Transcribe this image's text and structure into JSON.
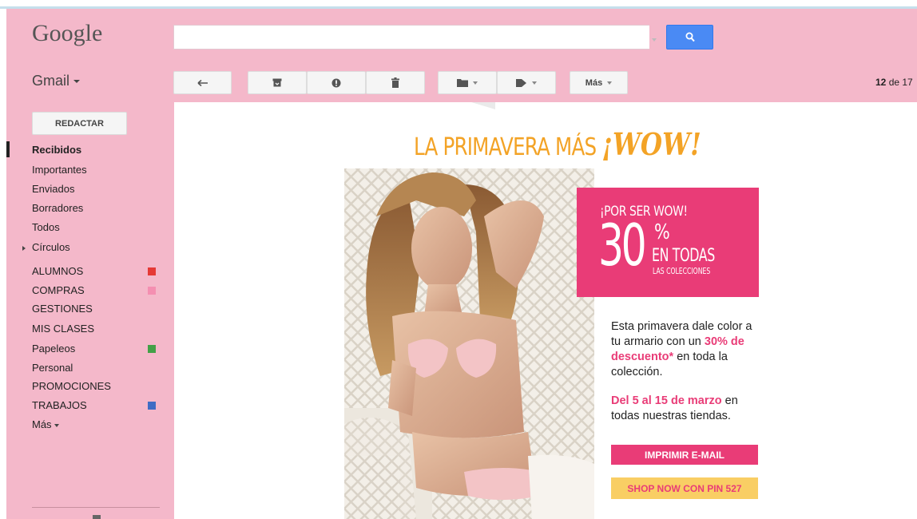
{
  "header": {
    "logo": "Google",
    "search": {
      "value": "",
      "placeholder": ""
    }
  },
  "toolbar": {
    "app_menu": "Gmail",
    "more_label": "Más",
    "counter_range": "12",
    "counter_of": "de 17"
  },
  "sidebar": {
    "compose_label": "REDACTAR",
    "items": [
      {
        "label": "Recibidos",
        "active": true
      },
      {
        "label": "Importantes"
      },
      {
        "label": "Enviados"
      },
      {
        "label": "Borradores"
      },
      {
        "label": "Todos"
      },
      {
        "label": "Círculos"
      }
    ],
    "labels": [
      {
        "label": "ALUMNOS",
        "color": "#e53935"
      },
      {
        "label": "COMPRAS",
        "color": "#f48fb1"
      },
      {
        "label": "GESTIONES",
        "color": ""
      },
      {
        "label": "MIS CLASES",
        "color": ""
      },
      {
        "label": "Papeleos",
        "color": "#43a047"
      },
      {
        "label": "Personal",
        "color": ""
      },
      {
        "label": "PROMOCIONES",
        "color": ""
      },
      {
        "label": "TRABAJOS",
        "color": "#3f6cc4"
      }
    ],
    "more_label": "Más"
  },
  "email": {
    "headline_main": "LA PRIMAVERA MÁS",
    "headline_wow": "¡WOW!",
    "promo": {
      "title": "¡POR SER WOW!",
      "percent": "30",
      "percent_sign": "%",
      "line1": "EN TODAS",
      "line2": "LAS COLECCIONES"
    },
    "body1_pre": "Esta primavera dale color a tu armario con un ",
    "body1_highlight": "30% de descuento*",
    "body1_post": " en toda la colección.",
    "body2_highlight": "Del 5 al 15 de marzo",
    "body2_post": " en todas nuestras tiendas.",
    "print_button": "IMPRIMIR E-MAIL",
    "shop_button": "SHOP NOW CON PIN 527"
  },
  "colors": {
    "theme_pink": "#f4b8ca",
    "accent_pink": "#e93c77",
    "accent_orange": "#f3a326",
    "accent_yellow": "#f9ce64",
    "search_blue": "#4a8af4"
  }
}
